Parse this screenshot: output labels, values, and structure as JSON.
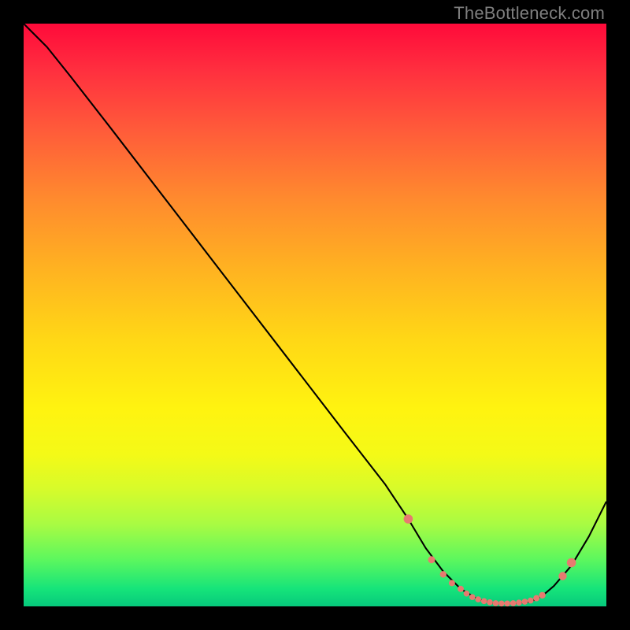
{
  "watermark": "TheBottleneck.com",
  "colors": {
    "line": "#000000",
    "marker": "#e77a70",
    "background_frame": "#000000"
  },
  "chart_data": {
    "type": "line",
    "title": "",
    "xlabel": "",
    "ylabel": "",
    "xlim": [
      0,
      100
    ],
    "ylim": [
      0,
      100
    ],
    "note": "Axes are implicit (no tick labels shown). x ≈ horizontal position 0–100, y ≈ bottleneck % (0 at bottom, 100 at top).",
    "series": [
      {
        "name": "bottleneck-curve",
        "x": [
          0,
          4,
          8,
          15,
          25,
          35,
          45,
          55,
          62,
          66,
          69,
          72,
          75,
          78,
          81,
          84,
          87,
          89,
          91,
          94,
          97,
          100
        ],
        "y": [
          100,
          96,
          91,
          82,
          69,
          56,
          43,
          30,
          21,
          15,
          10,
          6,
          3,
          1.2,
          0.5,
          0.5,
          0.8,
          1.8,
          3.5,
          7,
          12,
          18
        ]
      }
    ],
    "markers": {
      "name": "highlight-dots",
      "x": [
        66,
        70,
        72,
        73.5,
        75,
        76,
        77,
        78,
        79,
        80,
        81,
        82,
        83,
        84,
        85,
        86,
        87,
        88,
        89,
        92.5,
        94
      ],
      "y": [
        15,
        8,
        5.5,
        4,
        3,
        2.2,
        1.6,
        1.2,
        0.9,
        0.7,
        0.55,
        0.5,
        0.5,
        0.55,
        0.65,
        0.8,
        1.0,
        1.4,
        1.9,
        5.2,
        7.5
      ],
      "r": [
        5.8,
        4.5,
        4.2,
        4,
        4,
        3.8,
        3.8,
        3.8,
        3.8,
        3.8,
        3.8,
        3.8,
        3.8,
        3.8,
        3.8,
        3.8,
        3.8,
        4,
        4.2,
        5.2,
        5.8
      ]
    }
  }
}
